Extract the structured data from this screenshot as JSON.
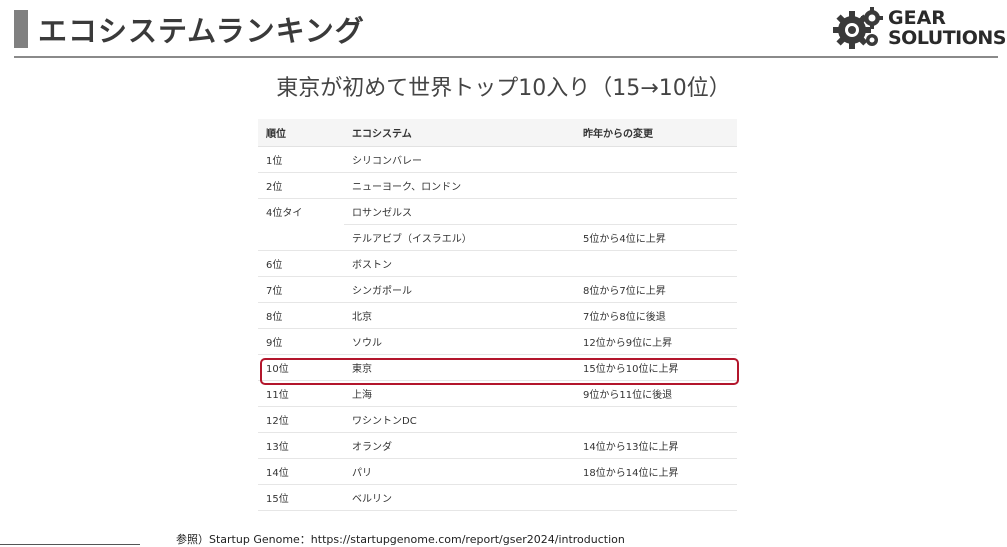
{
  "header": {
    "title": "エコシステムランキング",
    "logo_line1": "GEAR",
    "logo_line2": "SOLUTIONS"
  },
  "subtitle": "東京が初めて世界トップ10入り（15→10位）",
  "table": {
    "headers": [
      "順位",
      "エコシステム",
      "昨年からの変更"
    ],
    "rows": [
      {
        "rank": "1位",
        "ecosystem": "シリコンバレー",
        "change": ""
      },
      {
        "rank": "2位",
        "ecosystem": "ニューヨーク、ロンドン",
        "change": ""
      },
      {
        "rank": "4位タイ",
        "ecosystem": "ロサンゼルス",
        "change": ""
      },
      {
        "rank": "",
        "ecosystem": "テルアビブ（イスラエル）",
        "change": "5位から4位に上昇"
      },
      {
        "rank": "6位",
        "ecosystem": "ボストン",
        "change": ""
      },
      {
        "rank": "7位",
        "ecosystem": "シンガポール",
        "change": "8位から7位に上昇"
      },
      {
        "rank": "8位",
        "ecosystem": "北京",
        "change": "7位から8位に後退"
      },
      {
        "rank": "9位",
        "ecosystem": "ソウル",
        "change": "12位から9位に上昇"
      },
      {
        "rank": "10位",
        "ecosystem": "東京",
        "change": "15位から10位に上昇"
      },
      {
        "rank": "11位",
        "ecosystem": "上海",
        "change": "9位から11位に後退"
      },
      {
        "rank": "12位",
        "ecosystem": "ワシントンDC",
        "change": ""
      },
      {
        "rank": "13位",
        "ecosystem": "オランダ",
        "change": "14位から13位に上昇"
      },
      {
        "rank": "14位",
        "ecosystem": "パリ",
        "change": "18位から14位に上昇"
      },
      {
        "rank": "15位",
        "ecosystem": "ベルリン",
        "change": ""
      }
    ]
  },
  "footnote": "参照）Startup Genome：https://startupgenome.com/report/gser2024/introduction",
  "colors": {
    "highlight": "#b3162c",
    "title_bar": "#808080"
  }
}
